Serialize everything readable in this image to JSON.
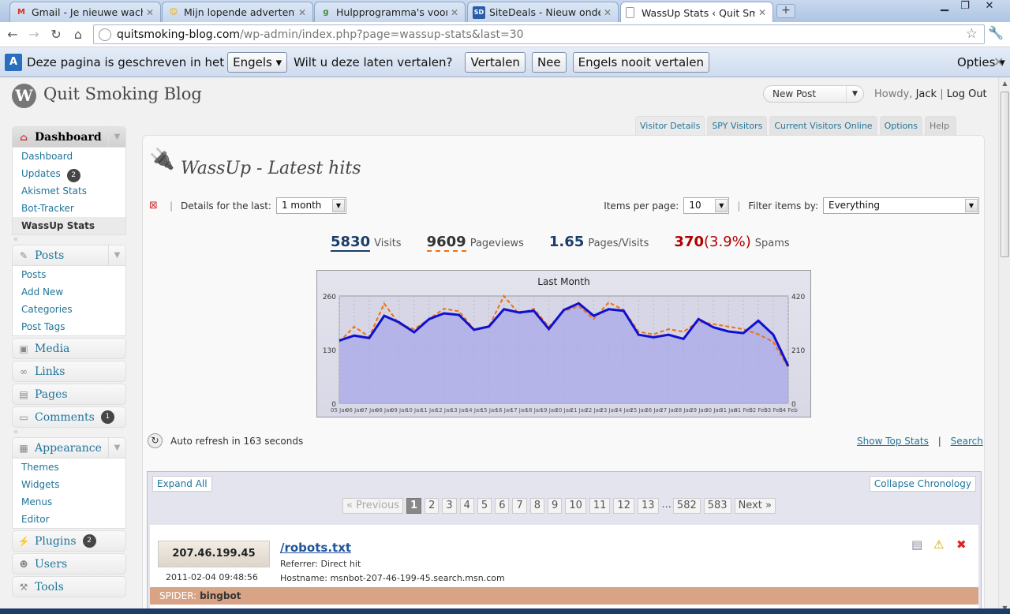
{
  "browser": {
    "tabs": [
      {
        "label": "Gmail - Je nieuwe wacht...",
        "icon": "gmail-icon",
        "glyph": "M",
        "color": "#d93025",
        "active": false
      },
      {
        "label": "Mijn lopende advertentie...",
        "icon": "marktplaats-icon",
        "glyph": "☺",
        "color": "#e8a400",
        "active": false
      },
      {
        "label": "Hulpprogramma's voor ...",
        "icon": "google-icon",
        "glyph": "g",
        "color": "#3b8d3b",
        "active": false
      },
      {
        "label": "SiteDeals - Nieuw onder...",
        "icon": "sitedeals-icon",
        "glyph": "SD",
        "color": "#2a5ea8",
        "active": false
      },
      {
        "label": "WassUp Stats ‹ Quit Smo...",
        "icon": "page-icon",
        "glyph": "",
        "color": "#fff",
        "active": true
      }
    ],
    "url_host": "quitsmoking-blog.com",
    "url_path": "/wp-admin/index.php?page=wassup-stats&last=30"
  },
  "translate_bar": {
    "text1": "Deze pagina is geschreven in het",
    "language": "Engels",
    "text2": "Wilt u deze laten vertalen?",
    "translate": "Vertalen",
    "no": "Nee",
    "never": "Engels nooit vertalen",
    "options": "Opties"
  },
  "wp_header": {
    "blog_title": "Quit Smoking Blog",
    "new_post": "New Post",
    "howdy": "Howdy,",
    "user": "Jack",
    "logout": "Log Out"
  },
  "sidebar": {
    "dashboard": {
      "label": "Dashboard",
      "items": [
        {
          "label": "Dashboard",
          "badge": ""
        },
        {
          "label": "Updates",
          "badge": "2"
        },
        {
          "label": "Akismet Stats",
          "badge": ""
        },
        {
          "label": "Bot-Tracker",
          "badge": ""
        },
        {
          "label": "WassUp Stats",
          "badge": "",
          "current": true
        }
      ]
    },
    "posts": {
      "label": "Posts",
      "items": [
        "Posts",
        "Add New",
        "Categories",
        "Post Tags"
      ]
    },
    "media": "Media",
    "links": "Links",
    "pages": "Pages",
    "comments": "Comments",
    "comments_badge": "1",
    "appearance": {
      "label": "Appearance",
      "items": [
        "Themes",
        "Widgets",
        "Menus",
        "Editor"
      ]
    },
    "plugins": "Plugins",
    "plugins_badge": "2",
    "users": "Users",
    "tools": "Tools"
  },
  "screen_meta": {
    "visitor_details": "Visitor Details",
    "spy": "SPY Visitors",
    "online": "Current Visitors Online",
    "options": "Options",
    "help": "Help"
  },
  "page": {
    "title": "WassUp - Latest hits",
    "details_label": "Details for the last:",
    "details_value": "1 month",
    "items_label": "Items per page:",
    "items_value": "10",
    "filter_label": "Filter items by:",
    "filter_value": "Everything",
    "sep": "|"
  },
  "stats": {
    "visits": "5830",
    "visits_label": "Visits",
    "pageviews": "9609",
    "pageviews_label": "Pageviews",
    "ppv": "1.65",
    "ppv_label": "Pages/Visits",
    "spams": "370",
    "spams_pct": "(3.9%)",
    "spams_label": "Spams"
  },
  "chart_data": {
    "type": "area",
    "title": "Last Month",
    "x": [
      "05 Jan",
      "06 Jan",
      "07 Jan",
      "08 Jan",
      "09 Jan",
      "10 Jan",
      "11 Jan",
      "12 Jan",
      "13 Jan",
      "14 Jan",
      "15 Jan",
      "16 Jan",
      "17 Jan",
      "18 Jan",
      "19 Jan",
      "20 Jan",
      "21 Jan",
      "22 Jan",
      "23 Jan",
      "24 Jan",
      "25 Jan",
      "26 Jan",
      "27 Jan",
      "28 Jan",
      "29 Jan",
      "30 Jan",
      "31 Jan",
      "01 Feb",
      "02 Feb",
      "03 Feb",
      "04 Feb"
    ],
    "x_tick_labels": [
      "05 Jan",
      "06 Jan",
      "07 Jan",
      "08 Jan",
      "09 Jan",
      "10 Jan",
      "11 Jan",
      "12 Jan",
      "13 Jan",
      "14 Jan",
      "15 Jan",
      "16 Jan",
      "17 Jan",
      "18 Jan",
      "19 Jan",
      "20 Jan",
      "21 Jan",
      "22 Jan",
      "23 Jan",
      "24 Jan",
      "25 Jan",
      "26 Jan",
      "27 Jan",
      "28 Jan",
      "29 Jan",
      "30 Jan",
      "31 Jan",
      "01 Feb",
      "02 Feb",
      "03 Feb",
      "04 Feb"
    ],
    "y_left_ticks": [
      "260",
      "130",
      "0"
    ],
    "y_right_ticks": [
      "420",
      "210",
      "0"
    ],
    "ylim_left": [
      0,
      260
    ],
    "ylim_right": [
      0,
      420
    ],
    "series": [
      {
        "name": "Visits",
        "axis": "left",
        "color": "#1010d0",
        "values": [
          152,
          164,
          158,
          212,
          196,
          172,
          204,
          218,
          214,
          178,
          186,
          228,
          220,
          224,
          180,
          226,
          242,
          212,
          228,
          224,
          166,
          160,
          166,
          156,
          204,
          184,
          174,
          170,
          200,
          166,
          90
        ]
      },
      {
        "name": "Pageviews",
        "axis": "right",
        "color": "#f07010",
        "values": [
          240,
          300,
          260,
          390,
          310,
          290,
          330,
          370,
          360,
          290,
          300,
          420,
          350,
          370,
          300,
          360,
          380,
          330,
          395,
          365,
          280,
          270,
          290,
          280,
          320,
          310,
          300,
          290,
          270,
          240,
          140
        ]
      }
    ]
  },
  "refresh": {
    "prefix": "Auto refresh in",
    "seconds": "163",
    "suffix": "seconds"
  },
  "top_links": {
    "show_top": "Show Top Stats",
    "sep": "|",
    "search": "Search"
  },
  "hits": {
    "expand": "Expand All",
    "collapse": "Collapse Chronology",
    "pager": [
      "« Previous",
      "1",
      "2",
      "3",
      "4",
      "5",
      "6",
      "7",
      "8",
      "9",
      "10",
      "11",
      "12",
      "13",
      "...",
      "582",
      "583",
      "Next »"
    ],
    "row": {
      "ip": "207.46.199.45",
      "date": "2011-02-04 09:48:56",
      "path": "/robots.txt",
      "referrer_label": "Referrer:",
      "referrer": "Direct hit",
      "hostname_label": "Hostname:",
      "hostname": "msnbot-207-46-199-45.search.msn.com",
      "spider_label": "SPIDER:",
      "spider": "bingbot"
    }
  },
  "colors": {
    "wp_link": "#21759b",
    "visits": "#1c3d6a",
    "pageviews": "#333",
    "ppv": "#1c3d6a",
    "spams": "#b00000"
  }
}
